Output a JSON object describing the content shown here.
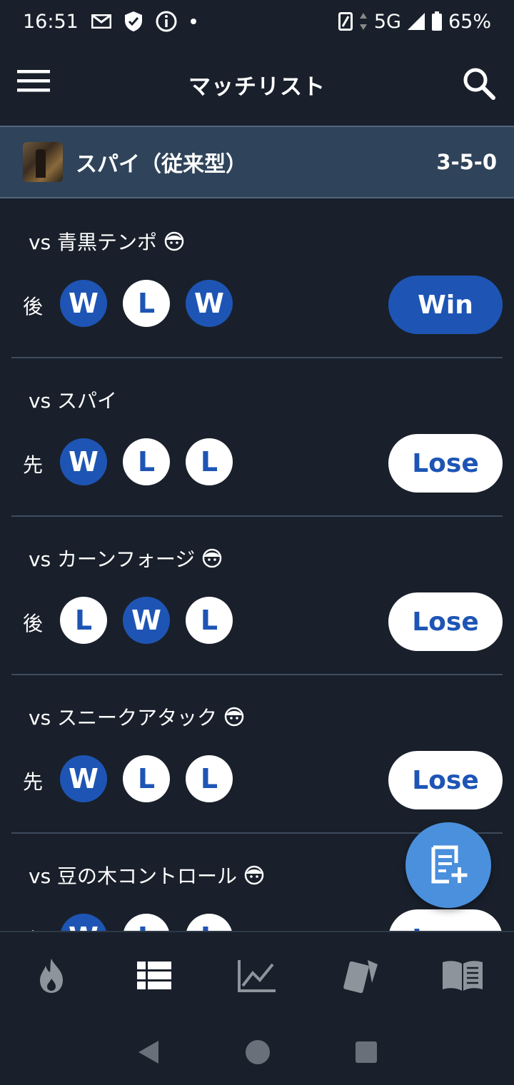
{
  "status_bar": {
    "time": "16:51",
    "network": "5G",
    "battery": "65%",
    "left_icons": [
      "mail-icon",
      "shield-icon",
      "info-icon",
      "dot-icon"
    ],
    "right_icons": [
      "nfc-icon",
      "data-arrows-icon",
      "signal-icon",
      "battery-icon"
    ]
  },
  "app_bar": {
    "title": "マッチリスト",
    "menu_icon": "hamburger-menu-icon",
    "search_icon": "search-icon"
  },
  "deck": {
    "name": "スパイ（従来型）",
    "record": "3-5-0"
  },
  "matches": [
    {
      "opponent": "vs 青黒テンポ",
      "has_face_icon": true,
      "turn": "後",
      "games": [
        "W",
        "L",
        "W"
      ],
      "result": "Win"
    },
    {
      "opponent": "vs スパイ",
      "has_face_icon": false,
      "turn": "先",
      "games": [
        "W",
        "L",
        "L"
      ],
      "result": "Lose"
    },
    {
      "opponent": "vs カーンフォージ",
      "has_face_icon": true,
      "turn": "後",
      "games": [
        "L",
        "W",
        "L"
      ],
      "result": "Lose"
    },
    {
      "opponent": "vs スニークアタック",
      "has_face_icon": true,
      "turn": "先",
      "games": [
        "W",
        "L",
        "L"
      ],
      "result": "Lose"
    },
    {
      "opponent": "vs 豆の木コントロール",
      "has_face_icon": true,
      "turn": "先",
      "games": [
        "W",
        "L",
        "L"
      ],
      "result": "Lose"
    }
  ],
  "fab": {
    "icon": "add-note-icon"
  },
  "bottom_nav": {
    "items": [
      "fire-icon",
      "list-icon",
      "chart-icon",
      "cards-icon",
      "book-icon"
    ],
    "active": "list-icon"
  },
  "system_nav": [
    "back-icon",
    "home-icon",
    "recents-icon"
  ],
  "colors": {
    "background": "#19202b",
    "header": "#2f435a",
    "accent_blue": "#1e55b5",
    "fab": "#4a90dd"
  }
}
